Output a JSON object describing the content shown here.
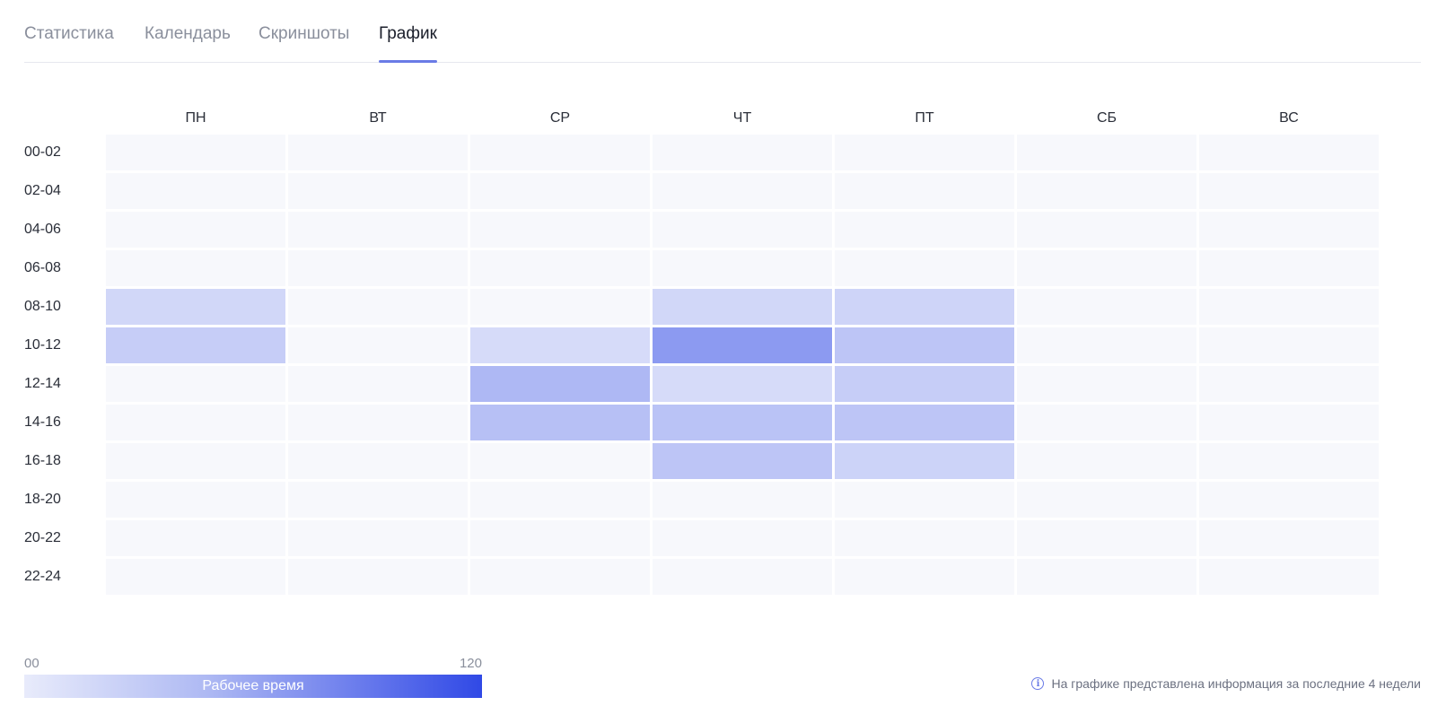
{
  "tabs": [
    {
      "label": "Статистика",
      "active": false
    },
    {
      "label": "Календарь",
      "active": false
    },
    {
      "label": "Скриншоты",
      "active": false
    },
    {
      "label": "График",
      "active": true
    }
  ],
  "chart_data": {
    "type": "heatmap",
    "columns": [
      "ПН",
      "ВТ",
      "СР",
      "ЧТ",
      "ПТ",
      "СБ",
      "ВС"
    ],
    "rows": [
      "00-02",
      "02-04",
      "04-06",
      "06-08",
      "08-10",
      "10-12",
      "12-14",
      "14-16",
      "16-18",
      "18-20",
      "20-22",
      "22-24"
    ],
    "values": [
      [
        0,
        0,
        0,
        0,
        0,
        0,
        0
      ],
      [
        0,
        0,
        0,
        0,
        0,
        0,
        0
      ],
      [
        0,
        0,
        0,
        0,
        0,
        0,
        0
      ],
      [
        0,
        0,
        0,
        0,
        0,
        0,
        0
      ],
      [
        15,
        0,
        0,
        15,
        17,
        0,
        0
      ],
      [
        22,
        0,
        12,
        60,
        28,
        0,
        0
      ],
      [
        0,
        0,
        38,
        12,
        22,
        0,
        0
      ],
      [
        0,
        0,
        32,
        30,
        28,
        0,
        0
      ],
      [
        0,
        0,
        0,
        28,
        18,
        0,
        0
      ],
      [
        0,
        0,
        0,
        0,
        0,
        0,
        0
      ],
      [
        0,
        0,
        0,
        0,
        0,
        0,
        0
      ],
      [
        0,
        0,
        0,
        0,
        0,
        0,
        0
      ]
    ],
    "scale_min": 0,
    "scale_max": 120,
    "colors": {
      "empty": "#f7f8fc",
      "low": "#e8ebfb",
      "high": "#3049e6"
    }
  },
  "legend": {
    "min_label": "00",
    "max_label": "120",
    "title": "Рабочее время"
  },
  "info": {
    "icon": "info-icon",
    "text": "На графике представлена информация за последние 4 недели"
  }
}
